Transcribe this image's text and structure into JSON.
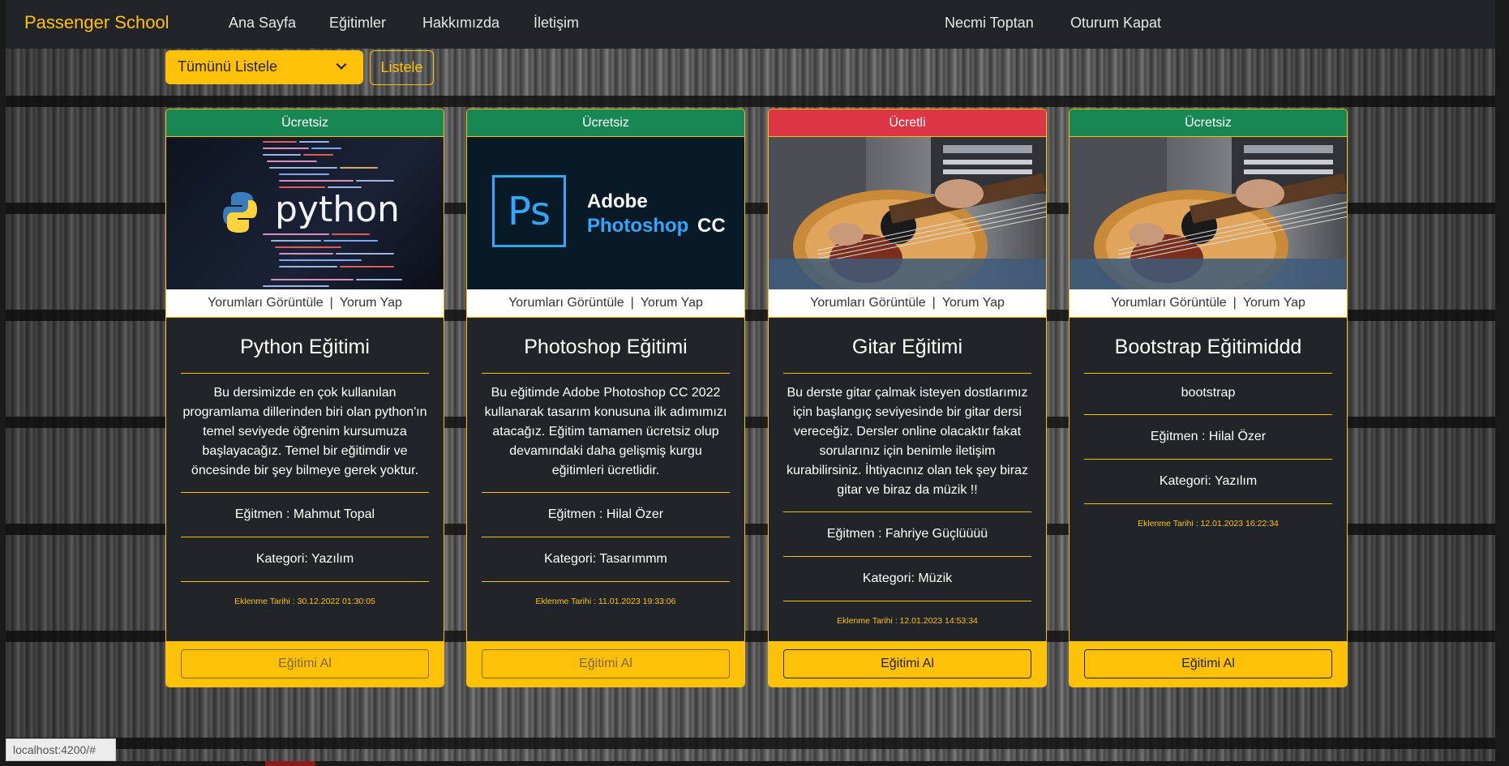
{
  "brand": "Passenger School",
  "nav": {
    "links": [
      "Ana Sayfa",
      "Eğitimler",
      "Hakkımızda",
      "İletişim"
    ],
    "user": "Necmi Toptan",
    "logout": "Oturum Kapat"
  },
  "filter": {
    "selected": "Tümünü Listele",
    "button": "Listele"
  },
  "card_links": {
    "view": "Yorumları Görüntüle",
    "separator": "|",
    "comment": "Yorum Yap"
  },
  "cards": [
    {
      "badge": "Ücretsiz",
      "badge_color": "#198754",
      "image": "python-image",
      "image_text": "python",
      "title": "Python Eğitimi",
      "desc": "Bu dersimizde en çok kullanılan programlama dillerinden biri olan python'ın temel seviyede öğrenim kursumuza başlayacağız. Temel bir eğitimdir ve öncesinde bir şey bilmeye gerek yoktur.",
      "instructor": "Eğitmen : Mahmut Topal",
      "category": "Kategori: Yazılım",
      "date": "Eklenme Tarihi : 30.12.2022 01:30:05",
      "button": "Eğitimi Al"
    },
    {
      "badge": "Ücretsiz",
      "badge_color": "#198754",
      "image": "photoshop-image",
      "image_logo": "Ps",
      "image_text1": "Adobe",
      "image_text2": "Photoshop",
      "image_text3": "CC",
      "title": "Photoshop Eğitimi",
      "desc": "Bu eğitimde Adobe Photoshop CC 2022 kullanarak tasarım konusuna ilk adımımızı atacağız. Eğitim tamamen ücretsiz olup devamındaki daha gelişmiş kurgu eğitimleri ücretlidir.",
      "instructor": "Eğitmen : Hilal Özer",
      "category": "Kategori: Tasarımmm",
      "date": "Eklenme Tarihi : 11.01.2023 19:33:06",
      "button": "Eğitimi Al"
    },
    {
      "badge": "Ücretli",
      "badge_color": "#dc3545",
      "image": "guitar-image",
      "title": "Gitar Eğitimi",
      "desc": "Bu derste gitar çalmak isteyen dostlarımız için başlangıç seviyesinde bir gitar dersi vereceğiz. Dersler online olacaktır fakat sorularınız için benimle iletişim kurabilirsiniz. İhtiyacınız olan tek şey biraz gitar ve biraz da müzik !!",
      "instructor": "Eğitmen : Fahriye Güçlüüüü",
      "category": "Kategori: Müzik",
      "date": "Eklenme Tarihi : 12.01.2023 14:53:34",
      "button": "Eğitimi Al"
    },
    {
      "badge": "Ücretsiz",
      "badge_color": "#198754",
      "image": "guitar-image",
      "title": "Bootstrap Eğitimiddd",
      "desc": "bootstrap",
      "instructor": "Eğitmen : Hilal Özer",
      "category": "Kategori: Yazılım",
      "date": "Eklenme Tarihi : 12.01.2023 16:22:34",
      "button": "Eğitimi Al"
    }
  ],
  "status_url": "localhost:4200/#"
}
